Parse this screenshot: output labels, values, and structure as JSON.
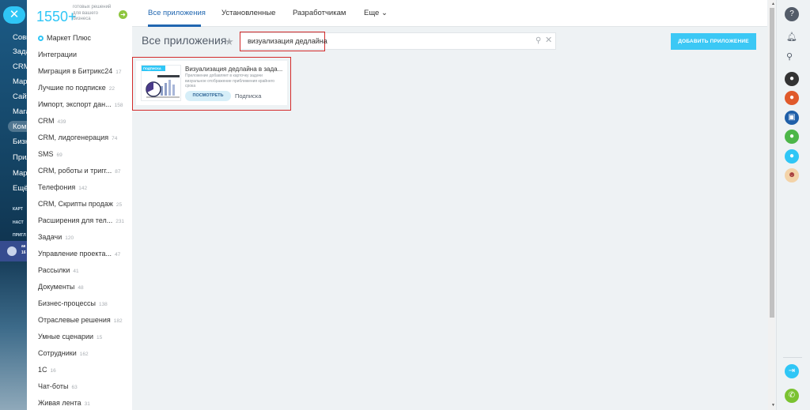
{
  "app_sidebar": {
    "items": [
      "Совм",
      "Зада",
      "CRM",
      "Марк",
      "Сайт",
      "Мага",
      "Комп",
      "Бизн",
      "Прил",
      "Марк",
      "Ещё"
    ],
    "small_items": [
      "КАРТ",
      "НАСТ",
      "ПРИГЛ"
    ],
    "promo_lines": [
      "ак",
      "16"
    ]
  },
  "brand": {
    "count": "1550+",
    "subtitle": "готовых решений для вашего бизнеса"
  },
  "categories": [
    {
      "label": "Маркет Плюс",
      "count": ""
    },
    {
      "label": "Интеграции",
      "count": ""
    },
    {
      "label": "Миграция в Битрикс24",
      "count": "17"
    },
    {
      "label": "Лучшие по подписке",
      "count": "22"
    },
    {
      "label": "Импорт, экспорт дан...",
      "count": "158"
    },
    {
      "label": "CRM",
      "count": "439"
    },
    {
      "label": "CRM, лидогенерация",
      "count": "74"
    },
    {
      "label": "SMS",
      "count": "69"
    },
    {
      "label": "CRM, роботы и тригг...",
      "count": "87"
    },
    {
      "label": "Телефония",
      "count": "142"
    },
    {
      "label": "CRM, Скрипты продаж",
      "count": "25"
    },
    {
      "label": "Расширения для тел...",
      "count": "231"
    },
    {
      "label": "Задачи",
      "count": "120"
    },
    {
      "label": "Управление проекта...",
      "count": "47"
    },
    {
      "label": "Рассылки",
      "count": "41"
    },
    {
      "label": "Документы",
      "count": "48"
    },
    {
      "label": "Бизнес-процессы",
      "count": "138"
    },
    {
      "label": "Отраслевые решения",
      "count": "182"
    },
    {
      "label": "Умные сценарии",
      "count": "15"
    },
    {
      "label": "Сотрудники",
      "count": "162"
    },
    {
      "label": "1С",
      "count": "16"
    },
    {
      "label": "Чат-боты",
      "count": "63"
    },
    {
      "label": "Живая лента",
      "count": "31"
    }
  ],
  "tabs": [
    "Все приложения",
    "Установленные",
    "Разработчикам",
    "Еще ⌄"
  ],
  "page_title": "Все приложения",
  "search": {
    "value": "визуализация дедлайна"
  },
  "add_button": "ДОБАВИТЬ ПРИЛОЖЕНИЕ",
  "app_card": {
    "ribbon": "ПОДПИСКА",
    "title": "Визуализация дедлайна в зада...",
    "description": "Приложение добавляет в карточку задачи визуальное отображение приближения крайнего срока",
    "view_button": "ПОСМОТРЕТЬ",
    "subscription": "Подписка"
  },
  "colors": {
    "accent": "#2fc6f6",
    "tab_active": "#2066b0",
    "highlight": "#d32b2b",
    "add_button": "#3bc8f5"
  }
}
